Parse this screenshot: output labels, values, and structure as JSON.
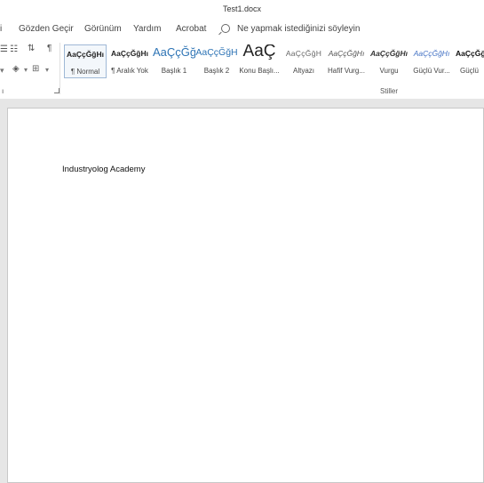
{
  "window": {
    "title": "Test1.docx"
  },
  "menu": {
    "items": [
      "i",
      "Gözden Geçir",
      "Görünüm",
      "Yardım",
      "Acrobat"
    ],
    "search_placeholder": "Ne yapmak istediğinizi söyleyin"
  },
  "ribbon": {
    "styles_group_label": "Stiller",
    "left_group_label": "ı",
    "styles": [
      {
        "preview": "AaÇçĞğHı",
        "label": "¶ Normal",
        "color": "#222222"
      },
      {
        "preview": "AaÇçĞğHı",
        "label": "¶ Aralık Yok",
        "color": "#222222"
      },
      {
        "preview": "AaÇçĞğ",
        "label": "Başlık 1",
        "color": "#2e74b5"
      },
      {
        "preview": "AaÇçĞğH",
        "label": "Başlık 2",
        "color": "#2e74b5"
      },
      {
        "preview": "AaÇ",
        "label": "Konu Başlı...",
        "color": "#222222"
      },
      {
        "preview": "AaÇçĞğH",
        "label": "Altyazı",
        "color": "#666666"
      },
      {
        "preview": "AaÇçĞğHı",
        "label": "Hafif Vurg...",
        "color": "#555555"
      },
      {
        "preview": "AaÇçĞğHı",
        "label": "Vurgu",
        "color": "#333333"
      },
      {
        "preview": "AaÇçĞğHı",
        "label": "Güçlü Vur...",
        "color": "#4472c4"
      },
      {
        "preview": "AaÇçĞğ",
        "label": "Güçlü",
        "color": "#111111"
      }
    ]
  },
  "document": {
    "text": "Industryolog Academy"
  }
}
